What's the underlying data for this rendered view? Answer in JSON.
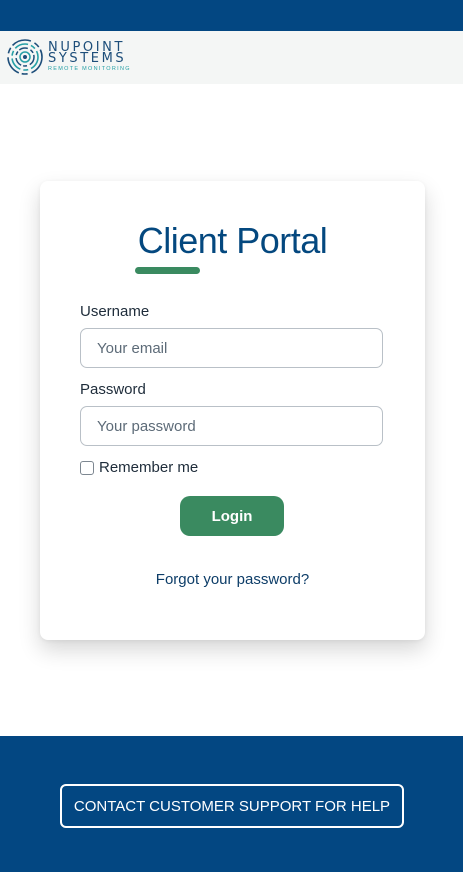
{
  "brand": {
    "line1": "NUPOINT",
    "line2": "SYSTEMS",
    "tagline": "REMOTE MONITORING",
    "logo_icon": "nupoint-logo-icon"
  },
  "login": {
    "title": "Client Portal",
    "username_label": "Username",
    "username_placeholder": "Your email",
    "password_label": "Password",
    "password_placeholder": "Your password",
    "remember_label": "Remember me",
    "login_button": "Login",
    "forgot_link": "Forgot your password?"
  },
  "footer": {
    "support_button": "CONTACT CUSTOMER SUPPORT FOR HELP"
  },
  "colors": {
    "primary_blue": "#034782",
    "accent_green": "#3a8a60",
    "logo_teal": "#26a0a6"
  }
}
